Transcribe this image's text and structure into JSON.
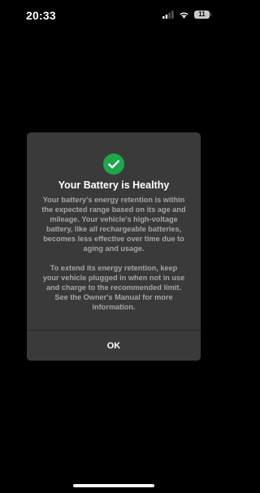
{
  "status_bar": {
    "time": "20:33",
    "battery_level": "11",
    "icons": [
      "signal-icon",
      "wifi-icon",
      "battery-icon"
    ]
  },
  "dialog": {
    "icon": "checkmark-circle-icon",
    "icon_color": "#1ca84a",
    "title": "Your Battery is Healthy",
    "paragraph1": "Your battery's energy retention is within the expected range based on its age and mileage. Your vehicle's high-voltage battery, like all rechargeable batteries, becomes less effective over time due to aging and usage.",
    "paragraph2": "To extend its energy retention, keep your vehicle plugged in when not in use and charge to the recommended limit. See the Owner's Manual for more information.",
    "ok_label": "OK"
  }
}
